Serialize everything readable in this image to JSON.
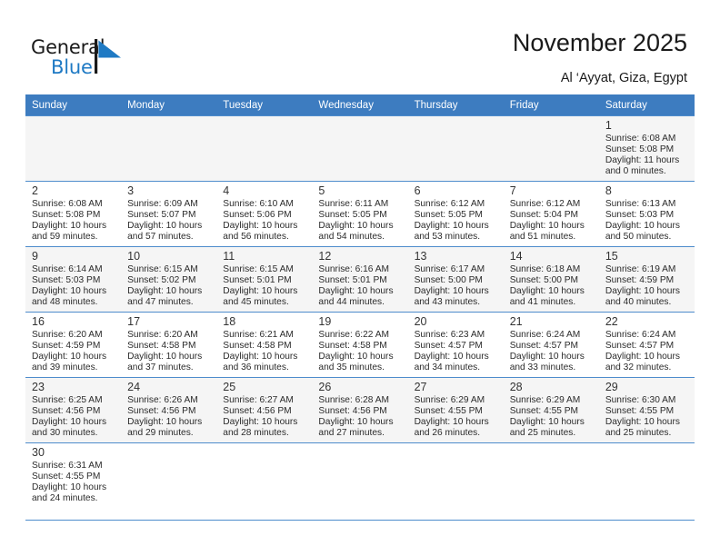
{
  "brand": {
    "name_part1": "General",
    "name_part2": "Blue",
    "mark": "blue-triangle-flag",
    "color_dark": "#1a1a1a",
    "color_blue": "#1f7ac4"
  },
  "header": {
    "title": "November 2025",
    "subtitle": "Al ‘Ayyat, Giza, Egypt"
  },
  "theme": {
    "header_row_bg": "#3d7cc0",
    "header_row_text": "#ffffff",
    "grid_line": "#4e8ccc",
    "alt_row_bg": "#f5f5f5"
  },
  "weekdays": [
    "Sunday",
    "Monday",
    "Tuesday",
    "Wednesday",
    "Thursday",
    "Friday",
    "Saturday"
  ],
  "labels": {
    "sunrise": "Sunrise:",
    "sunset": "Sunset:",
    "daylight": "Daylight:"
  },
  "weeks": [
    [
      {
        "empty": true
      },
      {
        "empty": true
      },
      {
        "empty": true
      },
      {
        "empty": true
      },
      {
        "empty": true
      },
      {
        "empty": true
      },
      {
        "day": "1",
        "sunrise": "Sunrise: 6:08 AM",
        "sunset": "Sunset: 5:08 PM",
        "daylight": "Daylight: 11 hours and 0 minutes."
      }
    ],
    [
      {
        "day": "2",
        "sunrise": "Sunrise: 6:08 AM",
        "sunset": "Sunset: 5:08 PM",
        "daylight": "Daylight: 10 hours and 59 minutes."
      },
      {
        "day": "3",
        "sunrise": "Sunrise: 6:09 AM",
        "sunset": "Sunset: 5:07 PM",
        "daylight": "Daylight: 10 hours and 57 minutes."
      },
      {
        "day": "4",
        "sunrise": "Sunrise: 6:10 AM",
        "sunset": "Sunset: 5:06 PM",
        "daylight": "Daylight: 10 hours and 56 minutes."
      },
      {
        "day": "5",
        "sunrise": "Sunrise: 6:11 AM",
        "sunset": "Sunset: 5:05 PM",
        "daylight": "Daylight: 10 hours and 54 minutes."
      },
      {
        "day": "6",
        "sunrise": "Sunrise: 6:12 AM",
        "sunset": "Sunset: 5:05 PM",
        "daylight": "Daylight: 10 hours and 53 minutes."
      },
      {
        "day": "7",
        "sunrise": "Sunrise: 6:12 AM",
        "sunset": "Sunset: 5:04 PM",
        "daylight": "Daylight: 10 hours and 51 minutes."
      },
      {
        "day": "8",
        "sunrise": "Sunrise: 6:13 AM",
        "sunset": "Sunset: 5:03 PM",
        "daylight": "Daylight: 10 hours and 50 minutes."
      }
    ],
    [
      {
        "day": "9",
        "sunrise": "Sunrise: 6:14 AM",
        "sunset": "Sunset: 5:03 PM",
        "daylight": "Daylight: 10 hours and 48 minutes."
      },
      {
        "day": "10",
        "sunrise": "Sunrise: 6:15 AM",
        "sunset": "Sunset: 5:02 PM",
        "daylight": "Daylight: 10 hours and 47 minutes."
      },
      {
        "day": "11",
        "sunrise": "Sunrise: 6:15 AM",
        "sunset": "Sunset: 5:01 PM",
        "daylight": "Daylight: 10 hours and 45 minutes."
      },
      {
        "day": "12",
        "sunrise": "Sunrise: 6:16 AM",
        "sunset": "Sunset: 5:01 PM",
        "daylight": "Daylight: 10 hours and 44 minutes."
      },
      {
        "day": "13",
        "sunrise": "Sunrise: 6:17 AM",
        "sunset": "Sunset: 5:00 PM",
        "daylight": "Daylight: 10 hours and 43 minutes."
      },
      {
        "day": "14",
        "sunrise": "Sunrise: 6:18 AM",
        "sunset": "Sunset: 5:00 PM",
        "daylight": "Daylight: 10 hours and 41 minutes."
      },
      {
        "day": "15",
        "sunrise": "Sunrise: 6:19 AM",
        "sunset": "Sunset: 4:59 PM",
        "daylight": "Daylight: 10 hours and 40 minutes."
      }
    ],
    [
      {
        "day": "16",
        "sunrise": "Sunrise: 6:20 AM",
        "sunset": "Sunset: 4:59 PM",
        "daylight": "Daylight: 10 hours and 39 minutes."
      },
      {
        "day": "17",
        "sunrise": "Sunrise: 6:20 AM",
        "sunset": "Sunset: 4:58 PM",
        "daylight": "Daylight: 10 hours and 37 minutes."
      },
      {
        "day": "18",
        "sunrise": "Sunrise: 6:21 AM",
        "sunset": "Sunset: 4:58 PM",
        "daylight": "Daylight: 10 hours and 36 minutes."
      },
      {
        "day": "19",
        "sunrise": "Sunrise: 6:22 AM",
        "sunset": "Sunset: 4:58 PM",
        "daylight": "Daylight: 10 hours and 35 minutes."
      },
      {
        "day": "20",
        "sunrise": "Sunrise: 6:23 AM",
        "sunset": "Sunset: 4:57 PM",
        "daylight": "Daylight: 10 hours and 34 minutes."
      },
      {
        "day": "21",
        "sunrise": "Sunrise: 6:24 AM",
        "sunset": "Sunset: 4:57 PM",
        "daylight": "Daylight: 10 hours and 33 minutes."
      },
      {
        "day": "22",
        "sunrise": "Sunrise: 6:24 AM",
        "sunset": "Sunset: 4:57 PM",
        "daylight": "Daylight: 10 hours and 32 minutes."
      }
    ],
    [
      {
        "day": "23",
        "sunrise": "Sunrise: 6:25 AM",
        "sunset": "Sunset: 4:56 PM",
        "daylight": "Daylight: 10 hours and 30 minutes."
      },
      {
        "day": "24",
        "sunrise": "Sunrise: 6:26 AM",
        "sunset": "Sunset: 4:56 PM",
        "daylight": "Daylight: 10 hours and 29 minutes."
      },
      {
        "day": "25",
        "sunrise": "Sunrise: 6:27 AM",
        "sunset": "Sunset: 4:56 PM",
        "daylight": "Daylight: 10 hours and 28 minutes."
      },
      {
        "day": "26",
        "sunrise": "Sunrise: 6:28 AM",
        "sunset": "Sunset: 4:56 PM",
        "daylight": "Daylight: 10 hours and 27 minutes."
      },
      {
        "day": "27",
        "sunrise": "Sunrise: 6:29 AM",
        "sunset": "Sunset: 4:55 PM",
        "daylight": "Daylight: 10 hours and 26 minutes."
      },
      {
        "day": "28",
        "sunrise": "Sunrise: 6:29 AM",
        "sunset": "Sunset: 4:55 PM",
        "daylight": "Daylight: 10 hours and 25 minutes."
      },
      {
        "day": "29",
        "sunrise": "Sunrise: 6:30 AM",
        "sunset": "Sunset: 4:55 PM",
        "daylight": "Daylight: 10 hours and 25 minutes."
      }
    ],
    [
      {
        "day": "30",
        "sunrise": "Sunrise: 6:31 AM",
        "sunset": "Sunset: 4:55 PM",
        "daylight": "Daylight: 10 hours and 24 minutes."
      },
      {
        "empty": true
      },
      {
        "empty": true
      },
      {
        "empty": true
      },
      {
        "empty": true
      },
      {
        "empty": true
      },
      {
        "empty": true
      }
    ]
  ]
}
